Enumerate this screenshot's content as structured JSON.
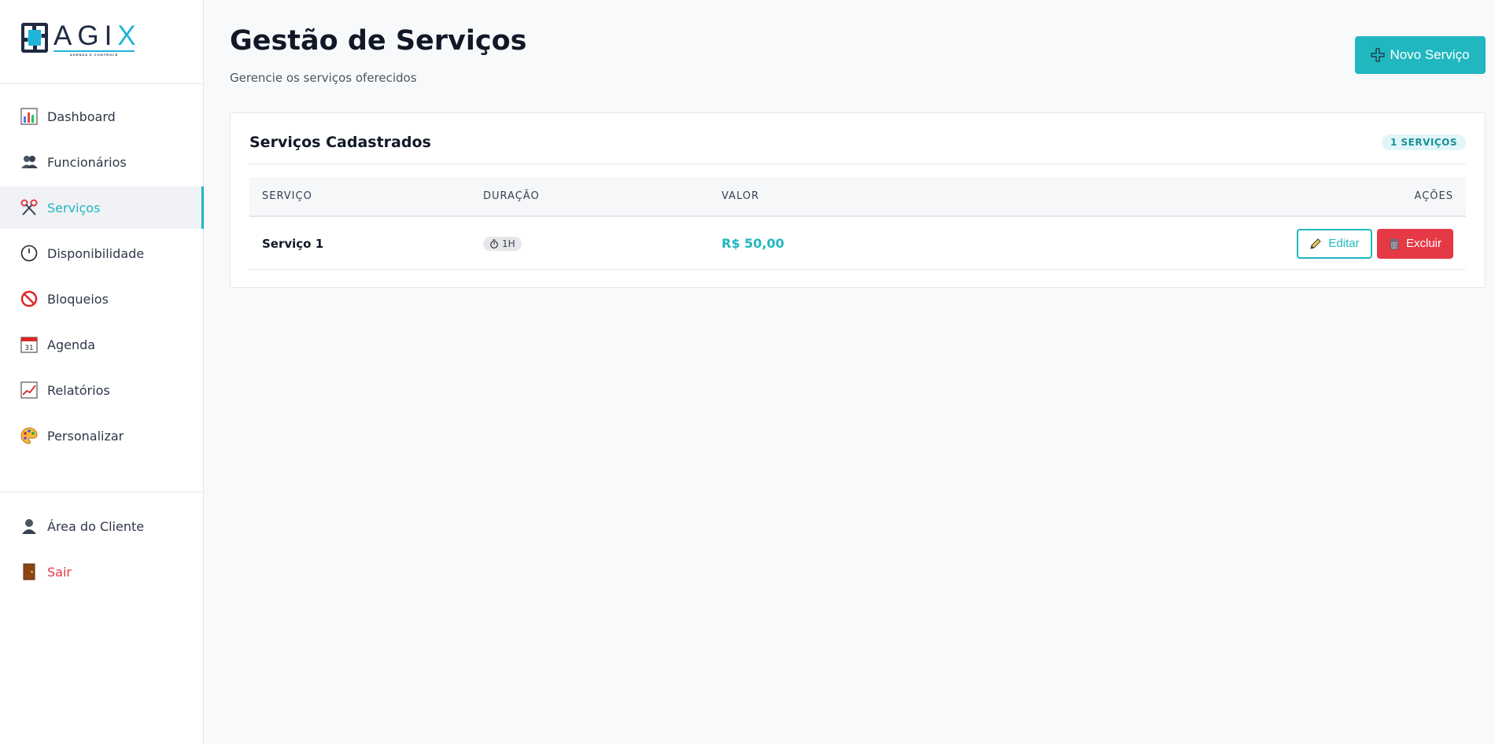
{
  "brand": {
    "word_main": "AGI",
    "word_accent": "X",
    "tagline": "AGENDA E CONTROLE",
    "accent_color": "#20b7bf"
  },
  "sidebar": {
    "items": [
      {
        "label": "Dashboard",
        "icon": "bar-chart-icon"
      },
      {
        "label": "Funcionários",
        "icon": "people-icon"
      },
      {
        "label": "Serviços",
        "icon": "scissors-icon",
        "active": true
      },
      {
        "label": "Disponibilidade",
        "icon": "clock-icon"
      },
      {
        "label": "Bloqueios",
        "icon": "prohibited-icon"
      },
      {
        "label": "Agenda",
        "icon": "calendar-icon"
      },
      {
        "label": "Relatórios",
        "icon": "line-chart-icon"
      },
      {
        "label": "Personalizar",
        "icon": "palette-icon"
      }
    ],
    "secondary": [
      {
        "label": "Área do Cliente",
        "icon": "user-icon"
      },
      {
        "label": "Sair",
        "icon": "door-icon"
      }
    ],
    "calendar_day": "31"
  },
  "header": {
    "title": "Gestão de Serviços",
    "subtitle": "Gerencie os serviços oferecidos",
    "new_button": "Novo Serviço"
  },
  "card": {
    "title": "Serviços Cadastrados",
    "count_badge": "1 SERVIÇOS"
  },
  "table": {
    "columns": [
      "SERVIÇO",
      "DURAÇÃO",
      "VALOR",
      "AÇÕES"
    ],
    "rows": [
      {
        "name": "Serviço 1",
        "duration": "1H",
        "price": "R$ 50,00"
      }
    ],
    "edit_label": "Editar",
    "delete_label": "Excluir"
  },
  "colors": {
    "accent": "#20b7bf",
    "danger": "#e53945",
    "background": "#f8f9fb"
  }
}
